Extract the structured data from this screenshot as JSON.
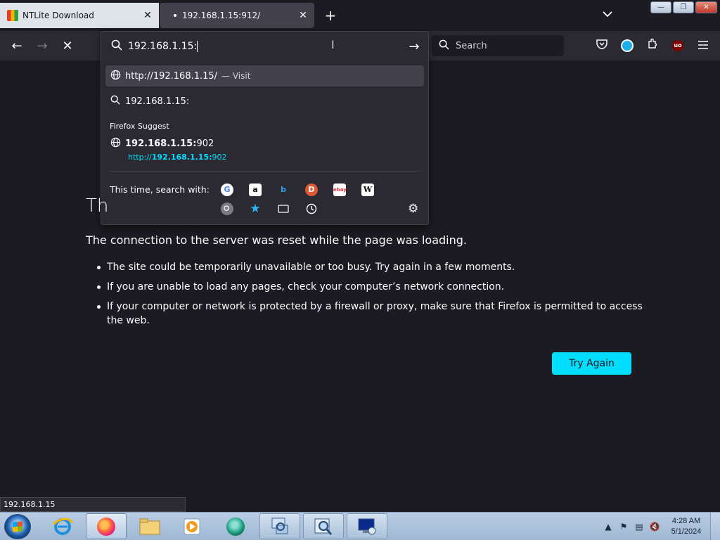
{
  "tabs": [
    {
      "label": "NTLite Download",
      "close": "✕"
    },
    {
      "label": "192.168.1.15:912/",
      "close": "✕"
    }
  ],
  "tabstrip": {
    "new_tab": "+",
    "tab_list": "⌄"
  },
  "window": {
    "minimize": "—",
    "restore": "❐",
    "close": "✕"
  },
  "nav": {
    "back": "←",
    "forward": "→",
    "stop": "✕"
  },
  "urlbar": {
    "value": "192.168.1.15:",
    "go": "→"
  },
  "dropdown": {
    "visit_url": "http://192.168.1.15/",
    "visit_action": "— Visit",
    "search_text": "192.168.1.15:",
    "suggest_heading": "Firefox Suggest",
    "suggest_title_bold": "192.168.1.15:",
    "suggest_title_rest": "902",
    "suggest_url_prefix": "http://",
    "suggest_url_bold": "192.168.1.15:",
    "suggest_url_rest": "902",
    "search_with_label": "This time, search with:",
    "engines": [
      {
        "name": "google",
        "glyph": "G",
        "color": "#ffffff",
        "fg": "#4285f4"
      },
      {
        "name": "amazon",
        "glyph": "a",
        "color": "#ffffff",
        "fg": "#111111"
      },
      {
        "name": "bing",
        "glyph": "b",
        "color": "transparent",
        "fg": "#2aa3ef"
      },
      {
        "name": "duckduckgo",
        "glyph": "D",
        "color": "#de5833",
        "fg": "#ffffff"
      },
      {
        "name": "ebay",
        "glyph": "ebay",
        "color": "#ffffff",
        "fg": "#e53238"
      },
      {
        "name": "wikipedia",
        "glyph": "W",
        "color": "#ffffff",
        "fg": "#111111"
      }
    ]
  },
  "toolbar": {
    "search_placeholder": "Search"
  },
  "error": {
    "title": "Th",
    "description": "The connection to the server was reset while the page was loading.",
    "bullets": [
      "The site could be temporarily unavailable or too busy. Try again in a few moments.",
      "If you are unable to load any pages, check your computer’s network connection.",
      "If your computer or network is protected by a firewall or proxy, make sure that Firefox is permitted to access the web."
    ],
    "try_again": "Try Again"
  },
  "statusbar": {
    "text": "192.168.1.15"
  },
  "taskbar": {
    "time": "4:28 AM",
    "date": "5/1/2024"
  },
  "colors": {
    "accent": "#00ddff",
    "page_bg": "#1c1b22",
    "toolbar_bg": "#2b2a33"
  }
}
